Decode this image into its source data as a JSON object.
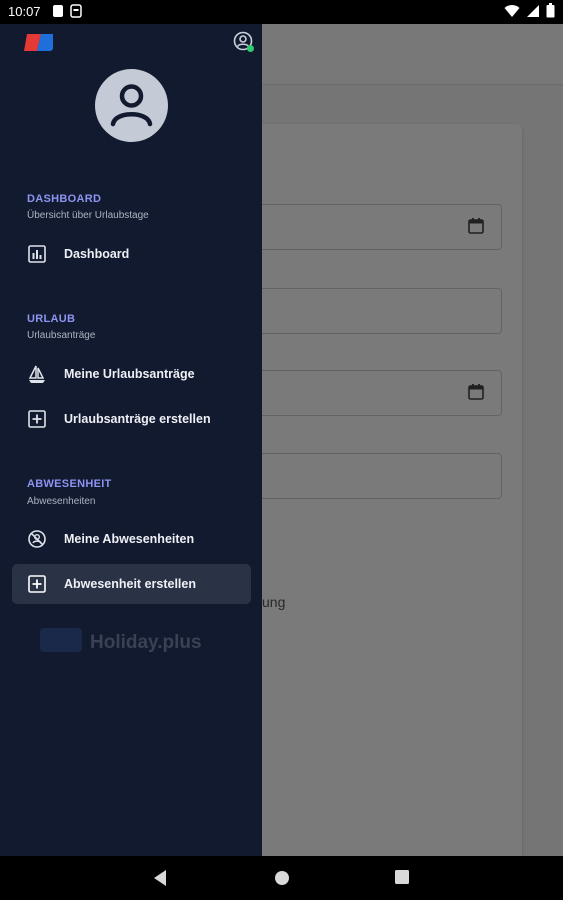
{
  "status": {
    "time": "10:07",
    "icons": [
      "sim-card-icon",
      "sim-alert-icon",
      "wifi-icon",
      "signal-icon",
      "battery-icon"
    ]
  },
  "drawer": {
    "sections": [
      {
        "title": "DASHBOARD",
        "subtitle": "Übersicht über Urlaubstage",
        "items": [
          {
            "label": "Dashboard",
            "icon": "bar-chart-icon",
            "active": false
          }
        ]
      },
      {
        "title": "URLAUB",
        "subtitle": "Urlaubsanträge",
        "items": [
          {
            "label": "Meine Urlaubsanträge",
            "icon": "sailboat-icon",
            "active": false
          },
          {
            "label": "Urlaubsanträge erstellen",
            "icon": "add-box-icon",
            "active": false
          }
        ]
      },
      {
        "title": "ABWESENHEIT",
        "subtitle": "Abwesenheiten",
        "items": [
          {
            "label": "Meine Abwesenheiten",
            "icon": "absence-icon",
            "active": false
          },
          {
            "label": "Abwesenheit erstellen",
            "icon": "add-box-icon",
            "active": true
          }
        ]
      }
    ],
    "watermark": "Holiday.plus"
  },
  "background": {
    "partial_text": "ung"
  },
  "colors": {
    "drawer_bg": "#111a2e",
    "section_title": "#8e93f1",
    "active_item_bg": "#2a3345",
    "online_dot": "#2ecc71"
  }
}
